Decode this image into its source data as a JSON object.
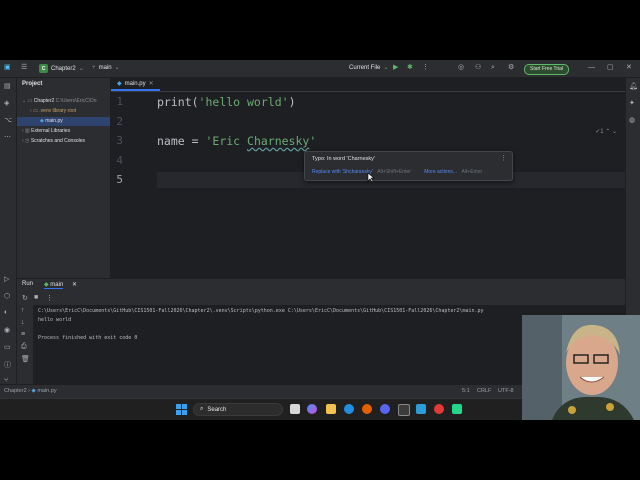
{
  "title_bar": {
    "project_badge": "C",
    "project_name": "Chapter2",
    "branch_icon": "branch-icon",
    "branch": "main",
    "run_config": "Current File",
    "trial_button": "Start Free Trial"
  },
  "project_panel": {
    "header": "Project",
    "items": [
      {
        "label": "Chapter2",
        "suffix": "C:\\Users\\EricC\\Do"
      },
      {
        "label": ".venv",
        "suffix": "library root"
      },
      {
        "label": "main.py"
      },
      {
        "label": "External Libraries"
      },
      {
        "label": "Scratches and Consoles"
      }
    ]
  },
  "editor": {
    "tab": "main.py",
    "line_numbers": [
      "1",
      "2",
      "3",
      "4",
      "5"
    ],
    "line1_fn": "print(",
    "line1_str": "'hello world'",
    "line1_close": ")",
    "line3_var": "name = ",
    "line3_str_open": "'Eric ",
    "line3_typo": "Charnesky",
    "line3_str_close": "'",
    "inspection": "✓1"
  },
  "popup": {
    "title": "Typo: In word 'Charnesky'",
    "action": "Replace with 'Shcharansky'",
    "action_shortcut": "Alt+Shift+Enter",
    "more": "More actions...",
    "more_shortcut": "Alt+Enter"
  },
  "run_panel": {
    "tab_run": "Run",
    "tab_main": "main",
    "lines": [
      "C:\\Users\\EricC\\Documents\\GitHub\\CIS1501-Fall2026\\Chapter2\\.venv\\Scripts\\python.exe C:\\Users\\EricC\\Documents\\GitHub\\CIS1501-Fall2026\\Chapter2\\main.py",
      "hello world",
      "",
      "Process finished with exit code 0"
    ]
  },
  "status_bar": {
    "crumb_project": "Chapter2",
    "crumb_file": "main.py",
    "position": "5:1",
    "line_sep": "CRLF",
    "encoding": "UTF-8"
  },
  "taskbar": {
    "search_placeholder": "Search"
  },
  "colors": {
    "accent": "#3574f0",
    "string": "#6aab73",
    "trial": "#5fb865"
  }
}
